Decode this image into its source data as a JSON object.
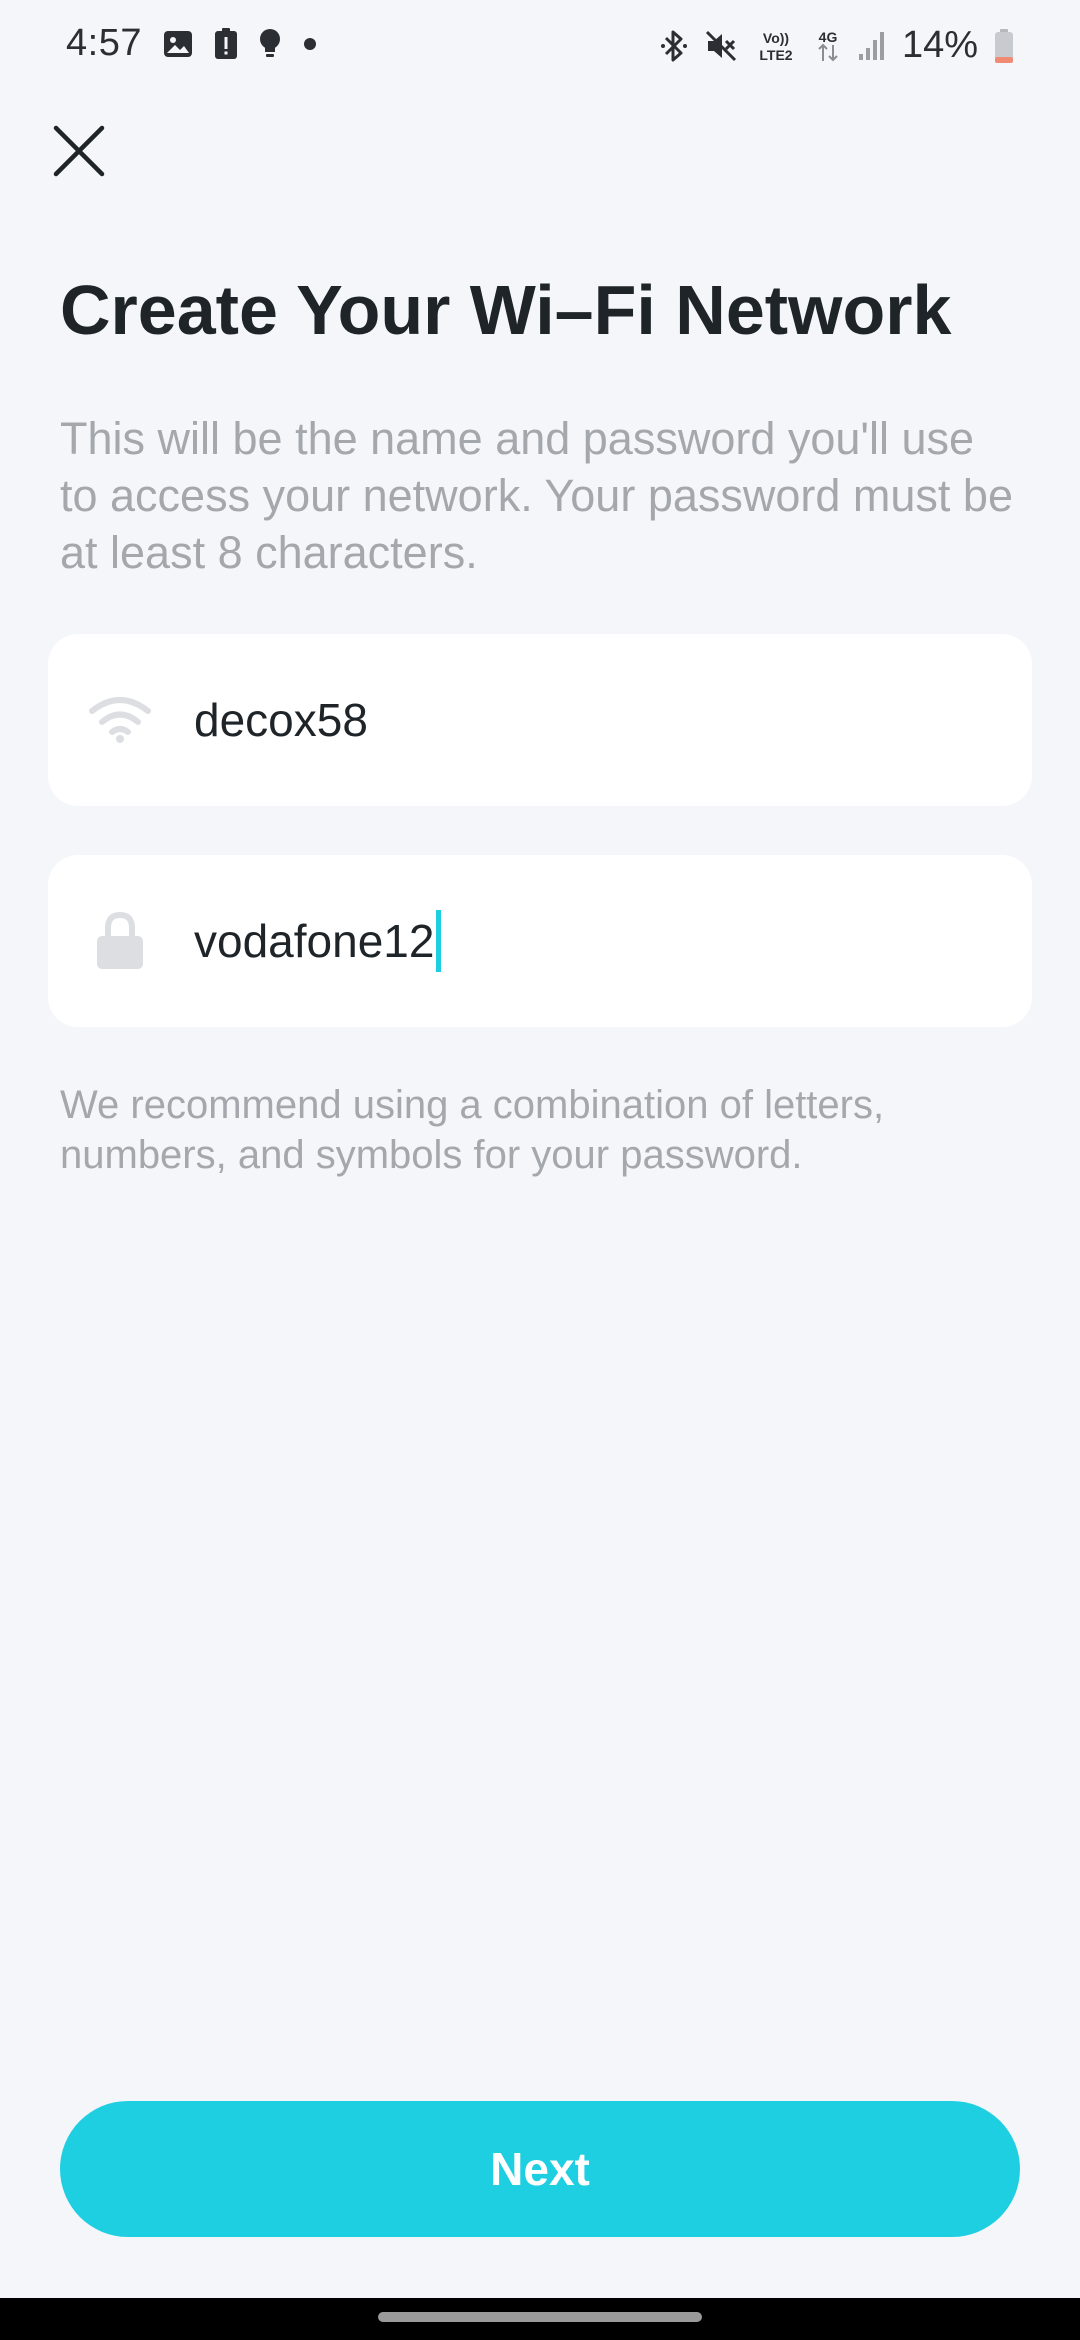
{
  "status_bar": {
    "time": "4:57",
    "battery_percent": "14%",
    "network_volte": "Vo))",
    "network_lte": "LTE2",
    "network_gen": "4G",
    "left_icons": [
      "gallery-icon",
      "alert-icon",
      "bulb-icon",
      "dot-icon"
    ],
    "right_icons": [
      "bluetooth-icon",
      "mute-icon",
      "volte-icon",
      "4g-icon",
      "signal-icon",
      "battery-icon"
    ]
  },
  "header": {
    "close_icon": "close-icon"
  },
  "main": {
    "title": "Create Your Wi–Fi Network",
    "description": "This will be the name and password you'll use to access your network. Your password must be at least 8 characters.",
    "fields": {
      "ssid": {
        "icon": "wifi-icon",
        "value": "decox58"
      },
      "password": {
        "icon": "lock-icon",
        "value": "vodafone12"
      }
    },
    "hint": "We recommend using a combination of letters, numbers, and symbols for your password."
  },
  "footer": {
    "next_label": "Next"
  },
  "colors": {
    "accent": "#1ecfe2",
    "background": "#f4f6fa",
    "field_background": "#ffffff",
    "title_text": "#1f2428",
    "secondary_text": "#a4a8ad",
    "battery_low": "#f08a74"
  }
}
